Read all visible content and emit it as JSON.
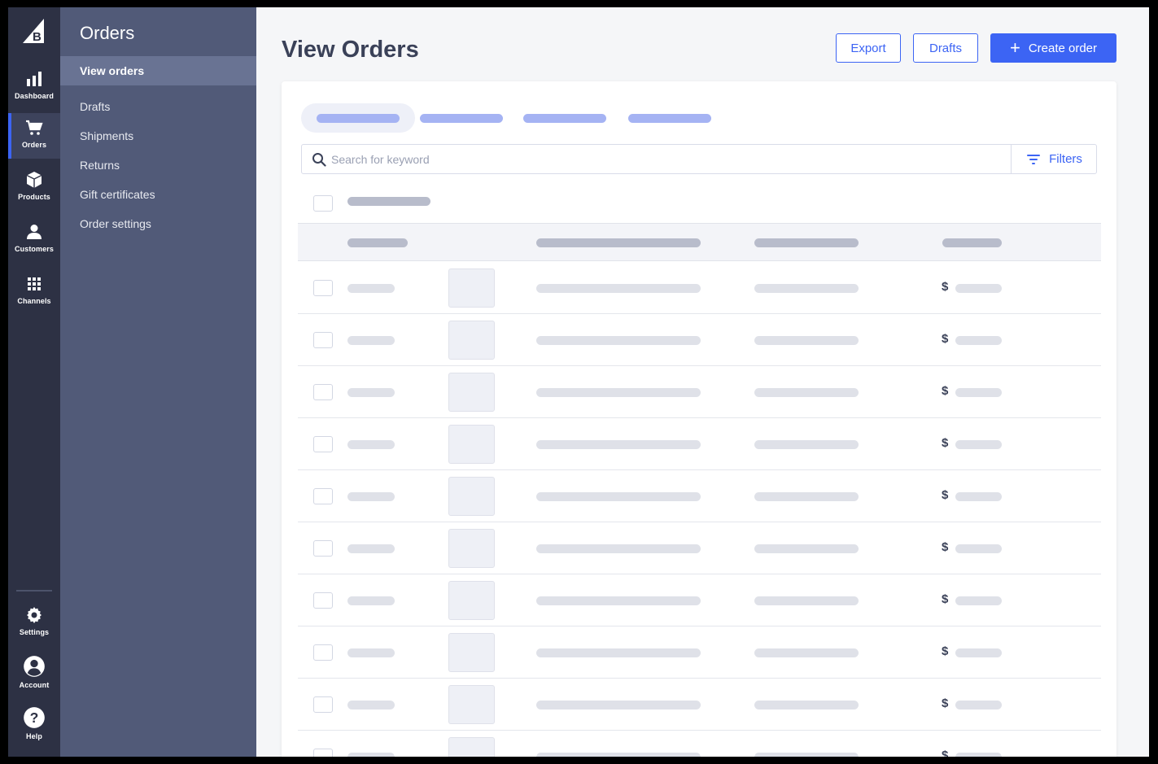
{
  "rail": {
    "items": [
      {
        "label": "Dashboard"
      },
      {
        "label": "Orders"
      },
      {
        "label": "Products"
      },
      {
        "label": "Customers"
      },
      {
        "label": "Channels"
      }
    ],
    "bottom": [
      {
        "label": "Settings"
      },
      {
        "label": "Account"
      },
      {
        "label": "Help"
      }
    ]
  },
  "subnav": {
    "title": "Orders",
    "items": [
      {
        "label": "View orders"
      },
      {
        "label": "Drafts"
      },
      {
        "label": "Shipments"
      },
      {
        "label": "Returns"
      },
      {
        "label": "Gift certificates"
      },
      {
        "label": "Order settings"
      }
    ]
  },
  "page": {
    "title": "View Orders",
    "export_label": "Export",
    "drafts_label": "Drafts",
    "create_label": "Create order"
  },
  "search": {
    "placeholder": "Search for keyword",
    "filters_label": "Filters"
  },
  "table": {
    "currency_symbol": "$"
  },
  "colors": {
    "accent": "#3c64f4",
    "rail": "#2d3144",
    "subnav": "#515a78"
  }
}
